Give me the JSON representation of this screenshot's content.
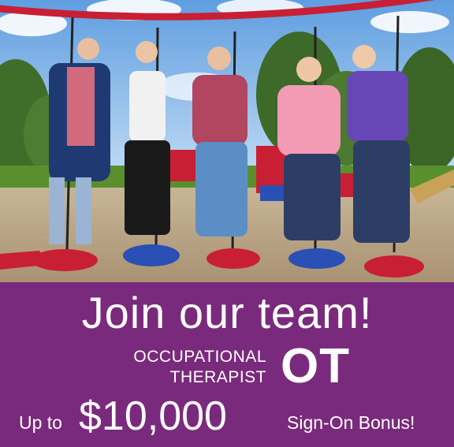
{
  "headline": "Join our team!",
  "position": {
    "line1": "OCCUPATIONAL",
    "line2": "THERAPIST",
    "abbreviation": "OT"
  },
  "bonus": {
    "prefix": "Up to",
    "amount": "$10,000",
    "label": "Sign-On Bonus!"
  },
  "colors": {
    "banner": "#7a2a7c",
    "text": "#ffffff",
    "swing_red": "#c81f35",
    "swing_blue": "#2a4fb5",
    "sky": "#7fb3e6",
    "grass": "#5a8f2e",
    "mulch": "#b8a585"
  }
}
